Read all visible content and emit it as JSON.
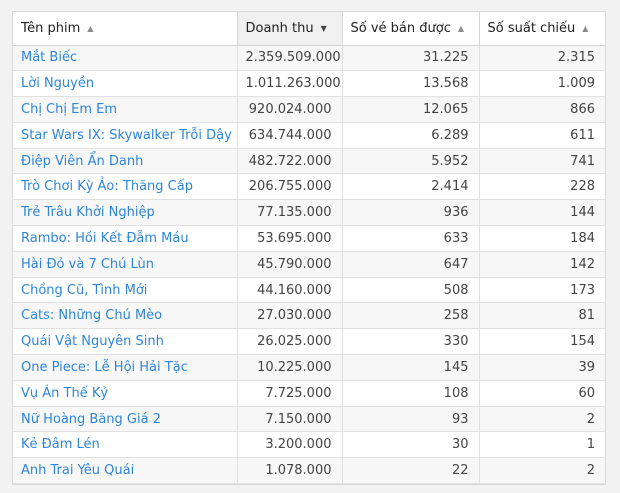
{
  "table": {
    "columns": [
      {
        "label": "Tên phim"
      },
      {
        "label": "Doanh thu"
      },
      {
        "label": "Số vé bán được"
      },
      {
        "label": "Số suất chiếu"
      }
    ],
    "sort": {
      "column": "Doanh thu",
      "direction": "descending"
    },
    "rows": [
      {
        "film": "Mắt Biếc",
        "revenue": "2.359.509.000",
        "tickets": "31.225",
        "screenings": "2.315"
      },
      {
        "film": "Lời Nguyền",
        "revenue": "1.011.263.000",
        "tickets": "13.568",
        "screenings": "1.009"
      },
      {
        "film": "Chị Chị Em Em",
        "revenue": "920.024.000",
        "tickets": "12.065",
        "screenings": "866"
      },
      {
        "film": "Star Wars IX: Skywalker Trỗi Dậy",
        "revenue": "634.744.000",
        "tickets": "6.289",
        "screenings": "611"
      },
      {
        "film": "Điệp Viên Ẩn Danh",
        "revenue": "482.722.000",
        "tickets": "5.952",
        "screenings": "741"
      },
      {
        "film": "Trò Chơi Kỳ Ảo: Thăng Cấp",
        "revenue": "206.755.000",
        "tickets": "2.414",
        "screenings": "228"
      },
      {
        "film": "Trẻ Trâu Khởi Nghiệp",
        "revenue": "77.135.000",
        "tickets": "936",
        "screenings": "144"
      },
      {
        "film": "Rambo: Hồi Kết Đẫm Máu",
        "revenue": "53.695.000",
        "tickets": "633",
        "screenings": "184"
      },
      {
        "film": "Hài Đỏ và 7 Chú Lùn",
        "revenue": "45.790.000",
        "tickets": "647",
        "screenings": "142"
      },
      {
        "film": "Chồng Cũ, Tình Mới",
        "revenue": "44.160.000",
        "tickets": "508",
        "screenings": "173"
      },
      {
        "film": "Cats: Những Chú Mèo",
        "revenue": "27.030.000",
        "tickets": "258",
        "screenings": "81"
      },
      {
        "film": "Quái Vật Nguyên Sinh",
        "revenue": "26.025.000",
        "tickets": "330",
        "screenings": "154"
      },
      {
        "film": "One Piece: Lễ Hội Hải Tặc",
        "revenue": "10.225.000",
        "tickets": "145",
        "screenings": "39"
      },
      {
        "film": "Vụ Án Thế Kỷ",
        "revenue": "7.725.000",
        "tickets": "108",
        "screenings": "60"
      },
      {
        "film": "Nữ Hoàng Băng Giá 2",
        "revenue": "7.150.000",
        "tickets": "93",
        "screenings": "2"
      },
      {
        "film": "Kẻ Đâm Lén",
        "revenue": "3.200.000",
        "tickets": "30",
        "screenings": "1"
      },
      {
        "film": "Anh Trai Yêu Quái",
        "revenue": "1.078.000",
        "tickets": "22",
        "screenings": "2"
      }
    ]
  }
}
